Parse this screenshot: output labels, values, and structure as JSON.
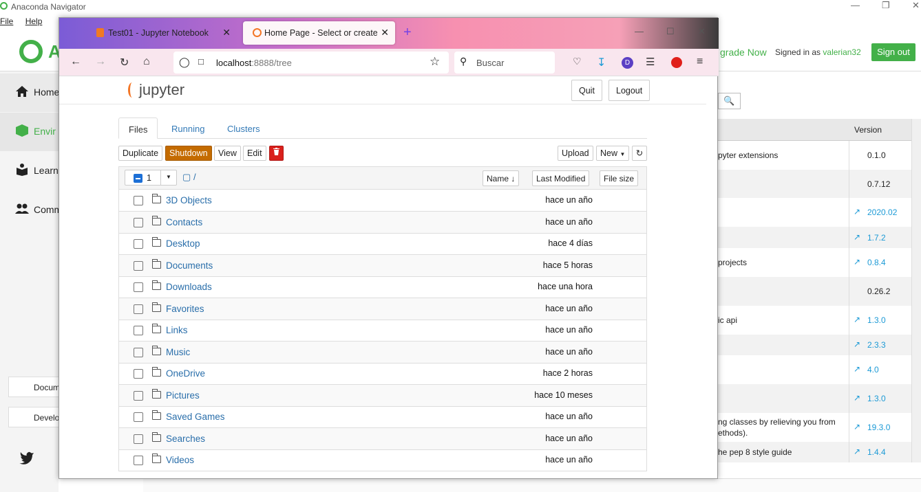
{
  "anaconda": {
    "window_title": "Anaconda Navigator",
    "menu": [
      "File",
      "Help"
    ],
    "brand_letter": "A",
    "upgrade": "grade Now",
    "signed_in_as": "Signed in as",
    "username": "valerian32",
    "sign_out": "Sign out",
    "nav": [
      "Home",
      "Envir",
      "Learn",
      "Comm"
    ],
    "side_buttons": [
      "Docum",
      "Develo"
    ],
    "table_header_version": "Version",
    "rows": [
      {
        "desc": "pyter extensions",
        "version": "0.1.0",
        "update": false
      },
      {
        "desc": "",
        "version": "0.7.12",
        "update": false
      },
      {
        "desc": "",
        "version": "2020.02",
        "update": true
      },
      {
        "desc": "",
        "version": "1.7.2",
        "update": true
      },
      {
        "desc": "projects",
        "version": "0.8.4",
        "update": true
      },
      {
        "desc": "",
        "version": "0.26.2",
        "update": false
      },
      {
        "desc": "ic api",
        "version": "1.3.0",
        "update": true
      },
      {
        "desc": "",
        "version": "2.3.3",
        "update": true
      },
      {
        "desc": "",
        "version": "4.0",
        "update": true
      },
      {
        "desc": "",
        "version": "1.3.0",
        "update": true
      },
      {
        "desc": "ng classes by relieving you from",
        "desc2": "ethods).",
        "version": "19.3.0",
        "update": true
      },
      {
        "desc": "he pep 8 style guide",
        "version": "1.4.4",
        "update": true
      }
    ]
  },
  "browser": {
    "tabs": [
      {
        "title": "Test01 - Jupyter Notebook"
      },
      {
        "title": "Home Page - Select or create a"
      }
    ],
    "url_host": "localhost",
    "url_rest": ":8888/tree",
    "search_placeholder": "Buscar",
    "profile_letter": "D"
  },
  "jupyter": {
    "logo_text": "jupyter",
    "quit": "Quit",
    "logout": "Logout",
    "tabs": [
      "Files",
      "Running",
      "Clusters"
    ],
    "toolbar": {
      "duplicate": "Duplicate",
      "shutdown": "Shutdown",
      "view": "View",
      "edit": "Edit",
      "upload": "Upload",
      "new": "New"
    },
    "selected_count": "1",
    "path": "/",
    "columns": {
      "name": "Name",
      "modified": "Last Modified",
      "size": "File size"
    },
    "files": [
      {
        "name": "3D Objects",
        "modified": "hace un año"
      },
      {
        "name": "Contacts",
        "modified": "hace un año"
      },
      {
        "name": "Desktop",
        "modified": "hace 4 días"
      },
      {
        "name": "Documents",
        "modified": "hace 5 horas"
      },
      {
        "name": "Downloads",
        "modified": "hace una hora"
      },
      {
        "name": "Favorites",
        "modified": "hace un año"
      },
      {
        "name": "Links",
        "modified": "hace un año"
      },
      {
        "name": "Music",
        "modified": "hace un año"
      },
      {
        "name": "OneDrive",
        "modified": "hace 2 horas"
      },
      {
        "name": "Pictures",
        "modified": "hace 10 meses"
      },
      {
        "name": "Saved Games",
        "modified": "hace un año"
      },
      {
        "name": "Searches",
        "modified": "hace un año"
      },
      {
        "name": "Videos",
        "modified": "hace un año"
      }
    ]
  },
  "colors": {
    "anaconda_green": "#43b049",
    "shutdown": "#c46b00",
    "delete": "#d9201c",
    "link": "#296eaa"
  }
}
